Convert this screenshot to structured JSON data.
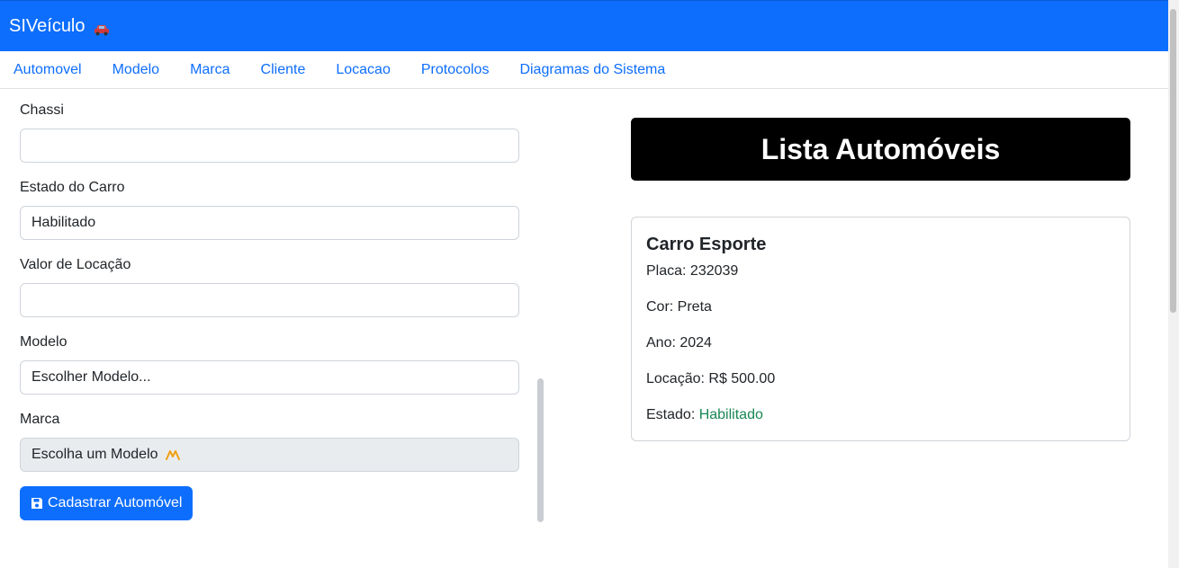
{
  "navbar": {
    "brand": "SIVeículo",
    "brand_icon": "car-icon"
  },
  "menu": [
    "Automovel",
    "Modelo",
    "Marca",
    "Cliente",
    "Locacao",
    "Protocolos",
    "Diagramas do Sistema"
  ],
  "form": {
    "chassi": {
      "label": "Chassi",
      "value": ""
    },
    "estado": {
      "label": "Estado do Carro",
      "value": "Habilitado"
    },
    "valor": {
      "label": "Valor de Locação",
      "value": ""
    },
    "modelo": {
      "label": "Modelo",
      "value": "Escolher Modelo..."
    },
    "marca": {
      "label": "Marca",
      "value": "Escolha um Modelo",
      "icon": "warning-icon"
    },
    "submit_label": "Cadastrar Automóvel",
    "submit_icon": "save-icon"
  },
  "list": {
    "title": "Lista Automóveis",
    "cards": [
      {
        "title": "Carro Esporte",
        "placa": "Placa: 232039",
        "cor": "Cor: Preta",
        "ano": "Ano: 2024",
        "locacao": "Locação: R$ 500.00",
        "estado_label": "Estado: ",
        "estado_value": "Habilitado"
      }
    ]
  },
  "colors": {
    "primary": "#0d6efd",
    "success": "#198754",
    "warning": "#f0a010"
  }
}
